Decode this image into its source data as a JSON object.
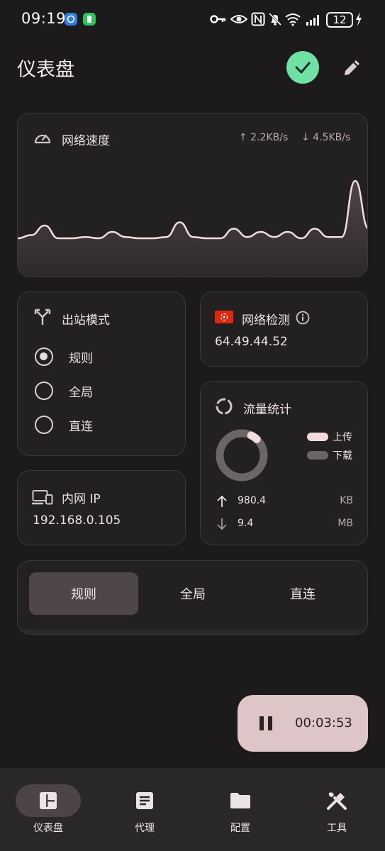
{
  "status_bar": {
    "time": "09:19",
    "battery": "12",
    "icons": [
      "app-notification-icon",
      "battery-app-icon",
      "vpn-key-icon",
      "eye-icon",
      "nfc-icon",
      "mute-bell-icon",
      "wifi-icon",
      "signal-icon",
      "battery-icon",
      "charging-bolt-icon"
    ]
  },
  "header": {
    "title": "仪表盘",
    "status_button_icon": "check-icon",
    "edit_button_icon": "pencil-icon"
  },
  "speed": {
    "title": "网络速度",
    "upload": "↑ 2.2KB/s",
    "download": "↓ 4.5KB/s",
    "trace": [
      0.1,
      0.15,
      0.3,
      0.1,
      0.1,
      0.12,
      0.1,
      0.2,
      0.12,
      0.1,
      0.1,
      0.12,
      0.35,
      0.12,
      0.1,
      0.1,
      0.25,
      0.12,
      0.2,
      0.12,
      0.2,
      0.1,
      0.25,
      0.12,
      0.12,
      1.0,
      0.25
    ]
  },
  "outbound_mode": {
    "title": "出站模式",
    "options": [
      {
        "label": "规则",
        "selected": true
      },
      {
        "label": "全局",
        "selected": false
      },
      {
        "label": "直连",
        "selected": false
      }
    ]
  },
  "network_check": {
    "title": "网络检测",
    "ip": "64.49.44.52",
    "flag": "hong-kong-flag-icon",
    "flag_color": "#de2910"
  },
  "traffic": {
    "title": "流量统计",
    "legend_upload": "上传",
    "legend_download": "下载",
    "upload_value": "980.4",
    "upload_unit": "KB",
    "download_value": "9.4",
    "download_unit": "MB",
    "upload_share": 0.05,
    "colors": {
      "upload": "#f0dcdd",
      "download": "#6a6566"
    }
  },
  "local_ip": {
    "title": "内网 IP",
    "ip": "192.168.0.105"
  },
  "mode_tabs": {
    "items": [
      "规则",
      "全局",
      "直连"
    ],
    "active": 0
  },
  "timer": {
    "time": "00:03:53",
    "icon": "pause-icon"
  },
  "bottom_nav": {
    "items": [
      {
        "label": "仪表盘",
        "icon": "dashboard-icon",
        "active": true
      },
      {
        "label": "代理",
        "icon": "article-icon",
        "active": false
      },
      {
        "label": "配置",
        "icon": "folder-icon",
        "active": false
      },
      {
        "label": "工具",
        "icon": "tools-icon",
        "active": false
      }
    ]
  },
  "colors": {
    "background": "#1c1a1b",
    "card": "#232022",
    "accent_green": "#6fe1a4",
    "timer_bg": "#dec5c6"
  }
}
